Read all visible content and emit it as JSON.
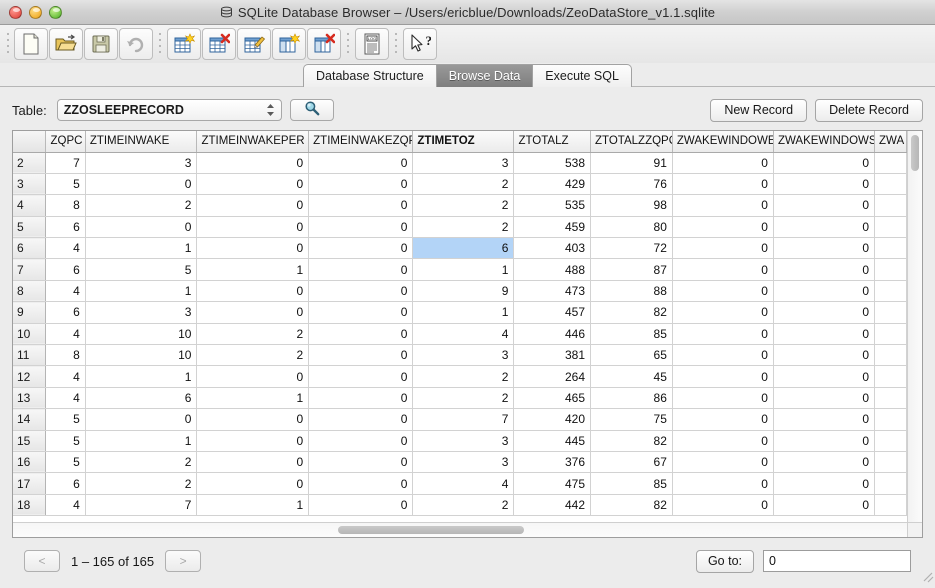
{
  "window": {
    "title": "SQLite Database Browser – /Users/ericblue/Downloads/ZeoDataStore_v1.1.sqlite",
    "title_icon": "database-icon",
    "traffic_lights": [
      {
        "name": "close-button",
        "color": "#e8584f"
      },
      {
        "name": "minimize-button",
        "color": "#f2b233"
      },
      {
        "name": "zoom-button",
        "color": "#6ec241"
      }
    ]
  },
  "toolbar": {
    "buttons": [
      {
        "icon": "new-database-icon",
        "label": "New Database"
      },
      {
        "icon": "open-database-icon",
        "label": "Open Database"
      },
      {
        "icon": "save-icon",
        "label": "Write Changes"
      },
      {
        "icon": "undo-icon",
        "label": "Revert Changes"
      },
      {
        "icon": "create-table-icon",
        "label": "Create Table"
      },
      {
        "icon": "delete-table-icon",
        "label": "Delete Table"
      },
      {
        "icon": "modify-table-icon",
        "label": "Modify Table"
      },
      {
        "icon": "create-index-icon",
        "label": "Create Index"
      },
      {
        "icon": "delete-index-icon",
        "label": "Delete Index"
      },
      {
        "icon": "log-icon",
        "label": "Log"
      },
      {
        "icon": "help-cursor-icon",
        "label": "What's This"
      }
    ]
  },
  "tabs": [
    {
      "label": "Database Structure",
      "active": false
    },
    {
      "label": "Browse Data",
      "active": true
    },
    {
      "label": "Execute SQL",
      "active": false
    }
  ],
  "controls": {
    "table_label": "Table:",
    "table_selected": "ZZOSLEEPRECORD",
    "search_icon": "magnifier-icon",
    "new_record_label": "New Record",
    "delete_record_label": "Delete Record"
  },
  "grid": {
    "row_header_label": "",
    "columns": [
      {
        "name": "ZQPC",
        "sorted": false
      },
      {
        "name": "ZTIMEINWAKE",
        "sorted": false
      },
      {
        "name": "ZTIMEINWAKEPER",
        "sorted": false
      },
      {
        "name": "ZTIMEINWAKEZQP",
        "sorted": false
      },
      {
        "name": "ZTIMETOZ",
        "sorted": true
      },
      {
        "name": "ZTOTALZ",
        "sorted": false
      },
      {
        "name": "ZTOTALZZQPOIN",
        "sorted": false
      },
      {
        "name": "ZWAKEWINDOWEN",
        "sorted": false
      },
      {
        "name": "ZWAKEWINDOWST",
        "sorted": false
      },
      {
        "name": "ZWA",
        "sorted": false
      }
    ],
    "selected_cell": {
      "row_index": 4,
      "column_index": 4
    },
    "rows": [
      {
        "id": "2",
        "cells": [
          "7",
          "3",
          "0",
          "0",
          "3",
          "538",
          "91",
          "0",
          "0",
          ""
        ]
      },
      {
        "id": "3",
        "cells": [
          "5",
          "0",
          "0",
          "0",
          "2",
          "429",
          "76",
          "0",
          "0",
          ""
        ]
      },
      {
        "id": "4",
        "cells": [
          "8",
          "2",
          "0",
          "0",
          "2",
          "535",
          "98",
          "0",
          "0",
          ""
        ]
      },
      {
        "id": "5",
        "cells": [
          "6",
          "0",
          "0",
          "0",
          "2",
          "459",
          "80",
          "0",
          "0",
          ""
        ]
      },
      {
        "id": "6",
        "cells": [
          "4",
          "1",
          "0",
          "0",
          "6",
          "403",
          "72",
          "0",
          "0",
          ""
        ]
      },
      {
        "id": "7",
        "cells": [
          "6",
          "5",
          "1",
          "0",
          "1",
          "488",
          "87",
          "0",
          "0",
          ""
        ]
      },
      {
        "id": "8",
        "cells": [
          "4",
          "1",
          "0",
          "0",
          "9",
          "473",
          "88",
          "0",
          "0",
          ""
        ]
      },
      {
        "id": "9",
        "cells": [
          "6",
          "3",
          "0",
          "0",
          "1",
          "457",
          "82",
          "0",
          "0",
          ""
        ]
      },
      {
        "id": "10",
        "cells": [
          "4",
          "10",
          "2",
          "0",
          "4",
          "446",
          "85",
          "0",
          "0",
          ""
        ]
      },
      {
        "id": "11",
        "cells": [
          "8",
          "10",
          "2",
          "0",
          "3",
          "381",
          "65",
          "0",
          "0",
          ""
        ]
      },
      {
        "id": "12",
        "cells": [
          "4",
          "1",
          "0",
          "0",
          "2",
          "264",
          "45",
          "0",
          "0",
          ""
        ]
      },
      {
        "id": "13",
        "cells": [
          "4",
          "6",
          "1",
          "0",
          "2",
          "465",
          "86",
          "0",
          "0",
          ""
        ]
      },
      {
        "id": "14",
        "cells": [
          "5",
          "0",
          "0",
          "0",
          "7",
          "420",
          "75",
          "0",
          "0",
          ""
        ]
      },
      {
        "id": "15",
        "cells": [
          "5",
          "1",
          "0",
          "0",
          "3",
          "445",
          "82",
          "0",
          "0",
          ""
        ]
      },
      {
        "id": "16",
        "cells": [
          "5",
          "2",
          "0",
          "0",
          "3",
          "376",
          "67",
          "0",
          "0",
          ""
        ]
      },
      {
        "id": "17",
        "cells": [
          "6",
          "2",
          "0",
          "0",
          "4",
          "475",
          "85",
          "0",
          "0",
          ""
        ]
      },
      {
        "id": "18",
        "cells": [
          "4",
          "7",
          "1",
          "0",
          "2",
          "442",
          "82",
          "0",
          "0",
          ""
        ]
      }
    ]
  },
  "pagination": {
    "prev_label": "<",
    "next_label": ">",
    "range_text": "1 – 165 of 165",
    "goto_label": "Go to:",
    "goto_value": "0"
  }
}
